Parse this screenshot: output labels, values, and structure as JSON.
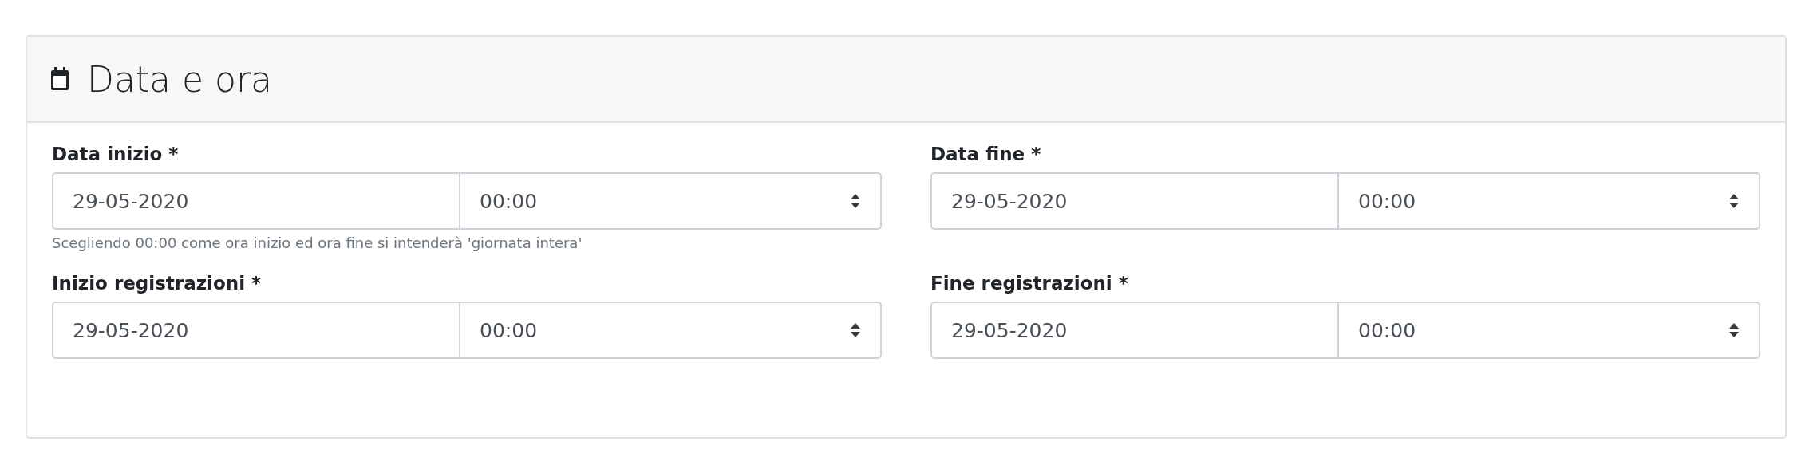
{
  "card": {
    "title": "Data e ora"
  },
  "fields": [
    {
      "label": "Data inizio *",
      "date": "29-05-2020",
      "time": "00:00",
      "hint": "Scegliendo 00:00 come ora inizio ed ora fine si intenderà 'giornata intera'"
    },
    {
      "label": "Data fine *",
      "date": "29-05-2020",
      "time": "00:00"
    },
    {
      "label": "Inizio registrazioni *",
      "date": "29-05-2020",
      "time": "00:00"
    },
    {
      "label": "Fine registrazioni *",
      "date": "29-05-2020",
      "time": "00:00"
    }
  ]
}
